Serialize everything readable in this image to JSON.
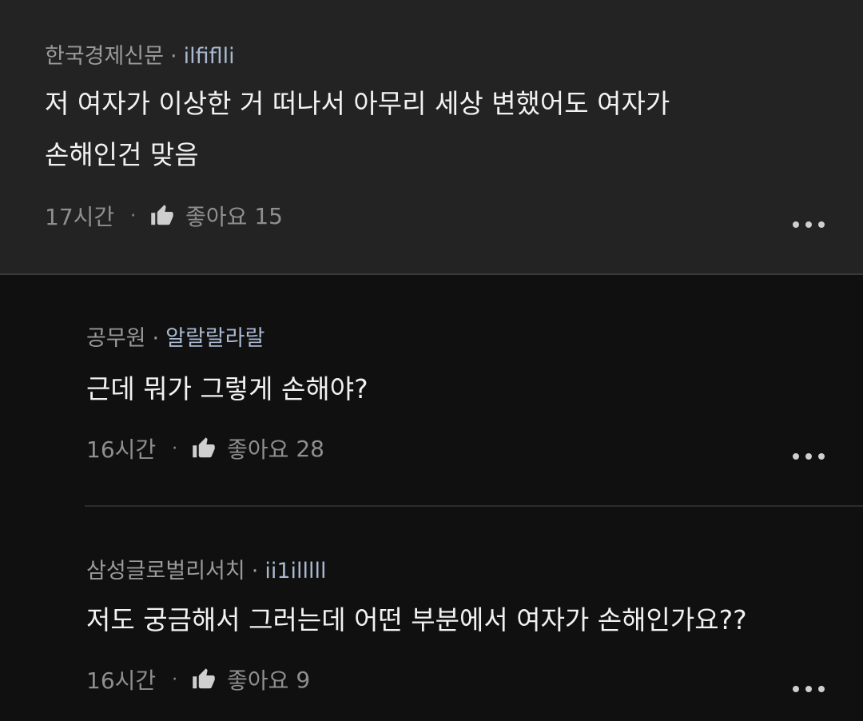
{
  "comments": [
    {
      "company": "한국경제신문",
      "nickname": "ilfiflli",
      "line1": "저 여자가 이상한 거 떠나서 아무리 세상 변했어도 여자가",
      "line2": "손해인건 맞음",
      "time": "17시간",
      "like_label": "좋아요",
      "like_count": "15"
    },
    {
      "company": "공무원",
      "nickname": "알랄랄라랄",
      "line1": "근데 뭐가 그렇게 손해야?",
      "time": "16시간",
      "like_label": "좋아요",
      "like_count": "28"
    },
    {
      "company": "삼성글로벌리서치",
      "nickname": "ii1illlll",
      "line1": "저도 궁금해서 그러는데 어떤 부분에서 여자가 손해인가요??",
      "time": "16시간",
      "like_label": "좋아요",
      "like_count": "9"
    }
  ],
  "separator": "·",
  "icons": {
    "like": "thumbs-up-icon",
    "more": "more-horizontal-icon"
  },
  "colors": {
    "top_bg": "#232323",
    "reply_bg": "#101010",
    "nickname": "#a9b8d0",
    "text": "#f2f2f2",
    "meta": "#9a9a9a"
  }
}
